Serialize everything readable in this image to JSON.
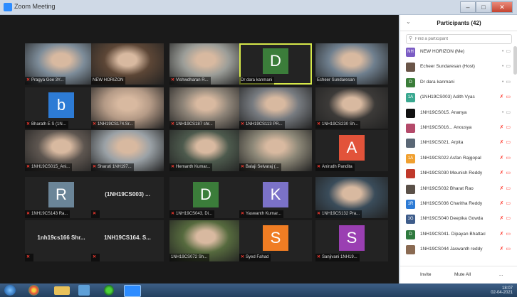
{
  "window": {
    "title": "Zoom Meeting",
    "minimize": "–",
    "maximize": "□",
    "close": "✕"
  },
  "tiles": [
    {
      "name": "Pragya Goe 3Y...",
      "type": "video",
      "bg": "#7d8c99",
      "muted": true
    },
    {
      "name": "NEW HORIZON",
      "type": "video",
      "bg": "#5c4636",
      "muted": false
    },
    {
      "name": "Vishwdharan R...",
      "type": "video",
      "bg": "#9b9d98",
      "muted": true
    },
    {
      "name": "Dr dara kanmani",
      "type": "avatar",
      "letter": "D",
      "color": "#3b7d3a",
      "muted": false,
      "active": true
    },
    {
      "name": "Echeer Sundaresan",
      "type": "video",
      "bg": "#6f7f8e",
      "muted": false
    },
    {
      "name": "Bharath E S (1N...",
      "type": "avatar",
      "letter": "b",
      "color": "#2d7bd5",
      "muted": true
    },
    {
      "name": "1NH19CS174.Sr...",
      "type": "video",
      "bg": "#b49a86",
      "muted": true
    },
    {
      "name": "1NH19CS187 shr...",
      "type": "video",
      "bg": "#8e8478",
      "muted": true
    },
    {
      "name": "1NH19CS113 PR...",
      "type": "video",
      "bg": "#777b80",
      "muted": true
    },
    {
      "name": "1NH19CS230 Sh...",
      "type": "video",
      "bg": "#3c3a38",
      "muted": true
    },
    {
      "name": "1NH19CS015_Ani...",
      "type": "video",
      "bg": "#5e5650",
      "muted": true
    },
    {
      "name": "Sharuti 1NH197...",
      "type": "video",
      "bg": "#9aa1a6",
      "muted": true
    },
    {
      "name": "Hemanth Kumar...",
      "type": "video",
      "bg": "#4d5a4d",
      "muted": true
    },
    {
      "name": "Balaji Selvaraj (...",
      "type": "video",
      "bg": "#8d8878",
      "muted": true
    },
    {
      "name": "Anirudh Pandita",
      "type": "avatar",
      "letter": "A",
      "color": "#e2533a",
      "muted": true
    },
    {
      "name": "1NH19CS143 Ra...",
      "type": "avatar",
      "letter": "R",
      "color": "#6b8598",
      "muted": true
    },
    {
      "name": "",
      "type": "text",
      "label": "(1NH19CS003) ...",
      "muted": true
    },
    {
      "name": "1NH19CS043, Di...",
      "type": "avatar",
      "letter": "D",
      "color": "#3b7d3a",
      "muted": true
    },
    {
      "name": "Yaswanth Kumar...",
      "type": "avatar",
      "letter": "K",
      "color": "#7b72c8",
      "muted": true
    },
    {
      "name": "1NH19CS132 Pra...",
      "type": "video",
      "bg": "#3a4c5a",
      "muted": true
    },
    {
      "name": "",
      "type": "text",
      "label": "1nh19cs166 Shr...",
      "muted": true
    },
    {
      "name": "",
      "type": "text",
      "label": "1NH19CS164. S...",
      "muted": true
    },
    {
      "name": "1NH19CS072 Sh...",
      "type": "video",
      "bg": "#566a3e",
      "muted": false
    },
    {
      "name": "Syed Fahad",
      "type": "avatar",
      "letter": "S",
      "color": "#f07d23",
      "muted": true
    },
    {
      "name": "Sanjivani 1NH19...",
      "type": "avatar",
      "letter": "S",
      "color": "#9a3fb2",
      "muted": true
    }
  ],
  "panel": {
    "title": "Participants (42)",
    "search_placeholder": "Find a participant",
    "participants": [
      {
        "name": "NEW HORIZON (Me)",
        "initials": "NH",
        "color": "#7b5cc4",
        "mic": "on",
        "cam": "on"
      },
      {
        "name": "Echeer Sundaresan (Host)",
        "initials": "",
        "color": "#6a5548",
        "mic": "on",
        "cam": "on"
      },
      {
        "name": "Dr dara kanmani",
        "initials": "D",
        "color": "#3b7d3a",
        "mic": "on",
        "cam": "on"
      },
      {
        "name": "(1NH19CS003) Adith Vyas",
        "initials": "1A",
        "color": "#3aa890",
        "mic": "off",
        "cam": "off"
      },
      {
        "name": "1NH19CS015. Ananya",
        "initials": "",
        "color": "#111111",
        "mic": "on",
        "cam": "on"
      },
      {
        "name": "1NH19CS016... Anousya",
        "initials": "",
        "color": "#b44a6a",
        "mic": "off",
        "cam": "off"
      },
      {
        "name": "1NH19CS021. Arpita",
        "initials": "",
        "color": "#5a6775",
        "mic": "off",
        "cam": "off"
      },
      {
        "name": "1NH19CS022 Asfan Rajgopal",
        "initials": "1A",
        "color": "#f0a030",
        "mic": "off",
        "cam": "off"
      },
      {
        "name": "1NH19CS030 Meunish Reddy",
        "initials": "",
        "color": "#c0392b",
        "mic": "off",
        "cam": "off"
      },
      {
        "name": "1NH19CS032 Bharat Rao",
        "initials": "",
        "color": "#5a5048",
        "mic": "off",
        "cam": "off"
      },
      {
        "name": "1NH19CS036 Charitha Reddy",
        "initials": "1R",
        "color": "#2d7bd5",
        "mic": "off",
        "cam": "off"
      },
      {
        "name": "1NH19CS040 Deepika Gowda",
        "initials": "1G",
        "color": "#3e5c8a",
        "mic": "off",
        "cam": "off"
      },
      {
        "name": "1NH19CS041. Dipayan Bhattach...",
        "initials": "D",
        "color": "#2f7a3e",
        "mic": "off",
        "cam": "off"
      },
      {
        "name": "1NH19CS044 Jaswanth reddy",
        "initials": "",
        "color": "#8a6a52",
        "mic": "off",
        "cam": "off"
      }
    ],
    "invite": "Invite",
    "mute_all": "Mute All",
    "more": "..."
  },
  "taskbar": {
    "time": "18:07",
    "date": "02-04-2021"
  },
  "icons": {
    "mic_on": "🎤",
    "mic_off": "🎤",
    "cam": "▢",
    "search": "⌕",
    "chevron": "⌄"
  }
}
